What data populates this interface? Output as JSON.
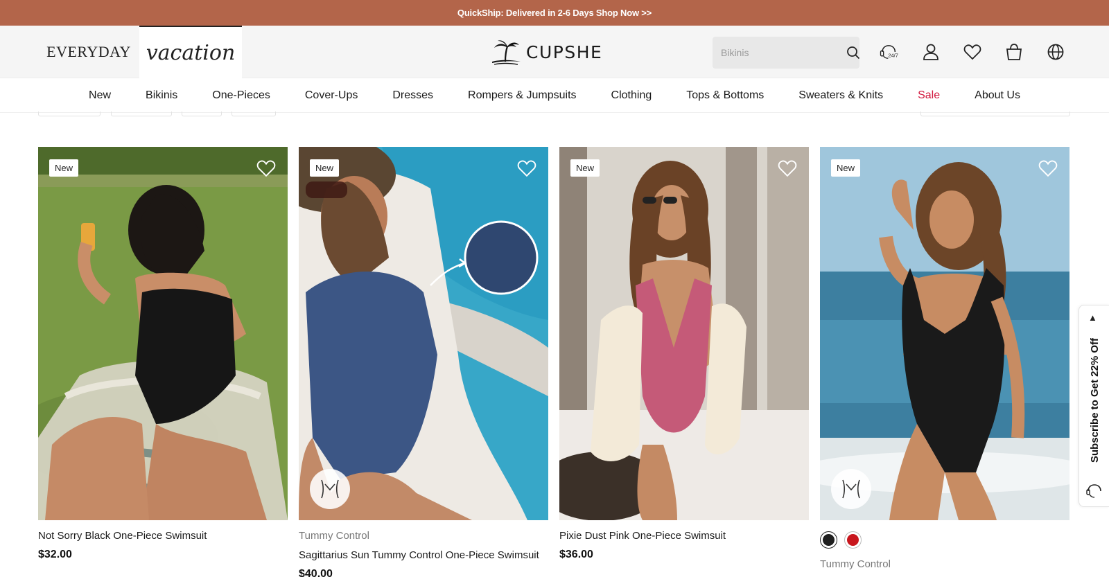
{
  "promo": {
    "text": "QuickShip: Delivered in 2-6 Days Shop Now >>"
  },
  "header": {
    "brand_tabs": [
      {
        "label": "EVERYDAY",
        "active": false
      },
      {
        "label": "vacation",
        "active": true
      }
    ],
    "logo": {
      "text": "CUPSHE",
      "icon": "palm-tree-logo-icon"
    },
    "search": {
      "placeholder": "Bikinis",
      "icon": "search-icon"
    },
    "icons": [
      "support-24-7-icon",
      "user-icon",
      "heart-icon",
      "bag-icon",
      "globe-icon"
    ],
    "support_label": "24/7"
  },
  "nav": {
    "items": [
      {
        "label": "New"
      },
      {
        "label": "Bikinis"
      },
      {
        "label": "One-Pieces"
      },
      {
        "label": "Cover-Ups"
      },
      {
        "label": "Dresses"
      },
      {
        "label": "Rompers & Jumpsuits"
      },
      {
        "label": "Clothing"
      },
      {
        "label": "Tops & Bottoms"
      },
      {
        "label": "Sweaters & Knits"
      },
      {
        "label": "Sale",
        "color": "#d2163d"
      },
      {
        "label": "About Us"
      }
    ]
  },
  "products": [
    {
      "badge": "New",
      "tag": "",
      "title": "Not Sorry Black One-Piece Swimsuit",
      "price": "$32.00",
      "image_desc": "black one-piece on grass",
      "tummy_control_icon": false
    },
    {
      "badge": "New",
      "tag": "Tummy Control",
      "title": "Sagittarius Sun Tummy Control One-Piece Swimsuit",
      "price": "$40.00",
      "image_desc": "navy one-piece poolside",
      "tummy_control_icon": true
    },
    {
      "badge": "New",
      "tag": "",
      "title": "Pixie Dust Pink One-Piece Swimsuit",
      "price": "$36.00",
      "image_desc": "pink one-piece in snow",
      "tummy_control_icon": false
    },
    {
      "badge": "New",
      "tag": "Tummy Control",
      "title": "",
      "price": "",
      "swatches": [
        "#1f1f1f",
        "#c8161d"
      ],
      "tummy_control_icon": true
    }
  ],
  "subscribe": {
    "label": "Subscribe to Get 22% Off",
    "arrow": "▲"
  },
  "colors": {
    "promo_bg": "#b3654a",
    "sale": "#d2163d",
    "header_bg": "#f5f5f5"
  }
}
